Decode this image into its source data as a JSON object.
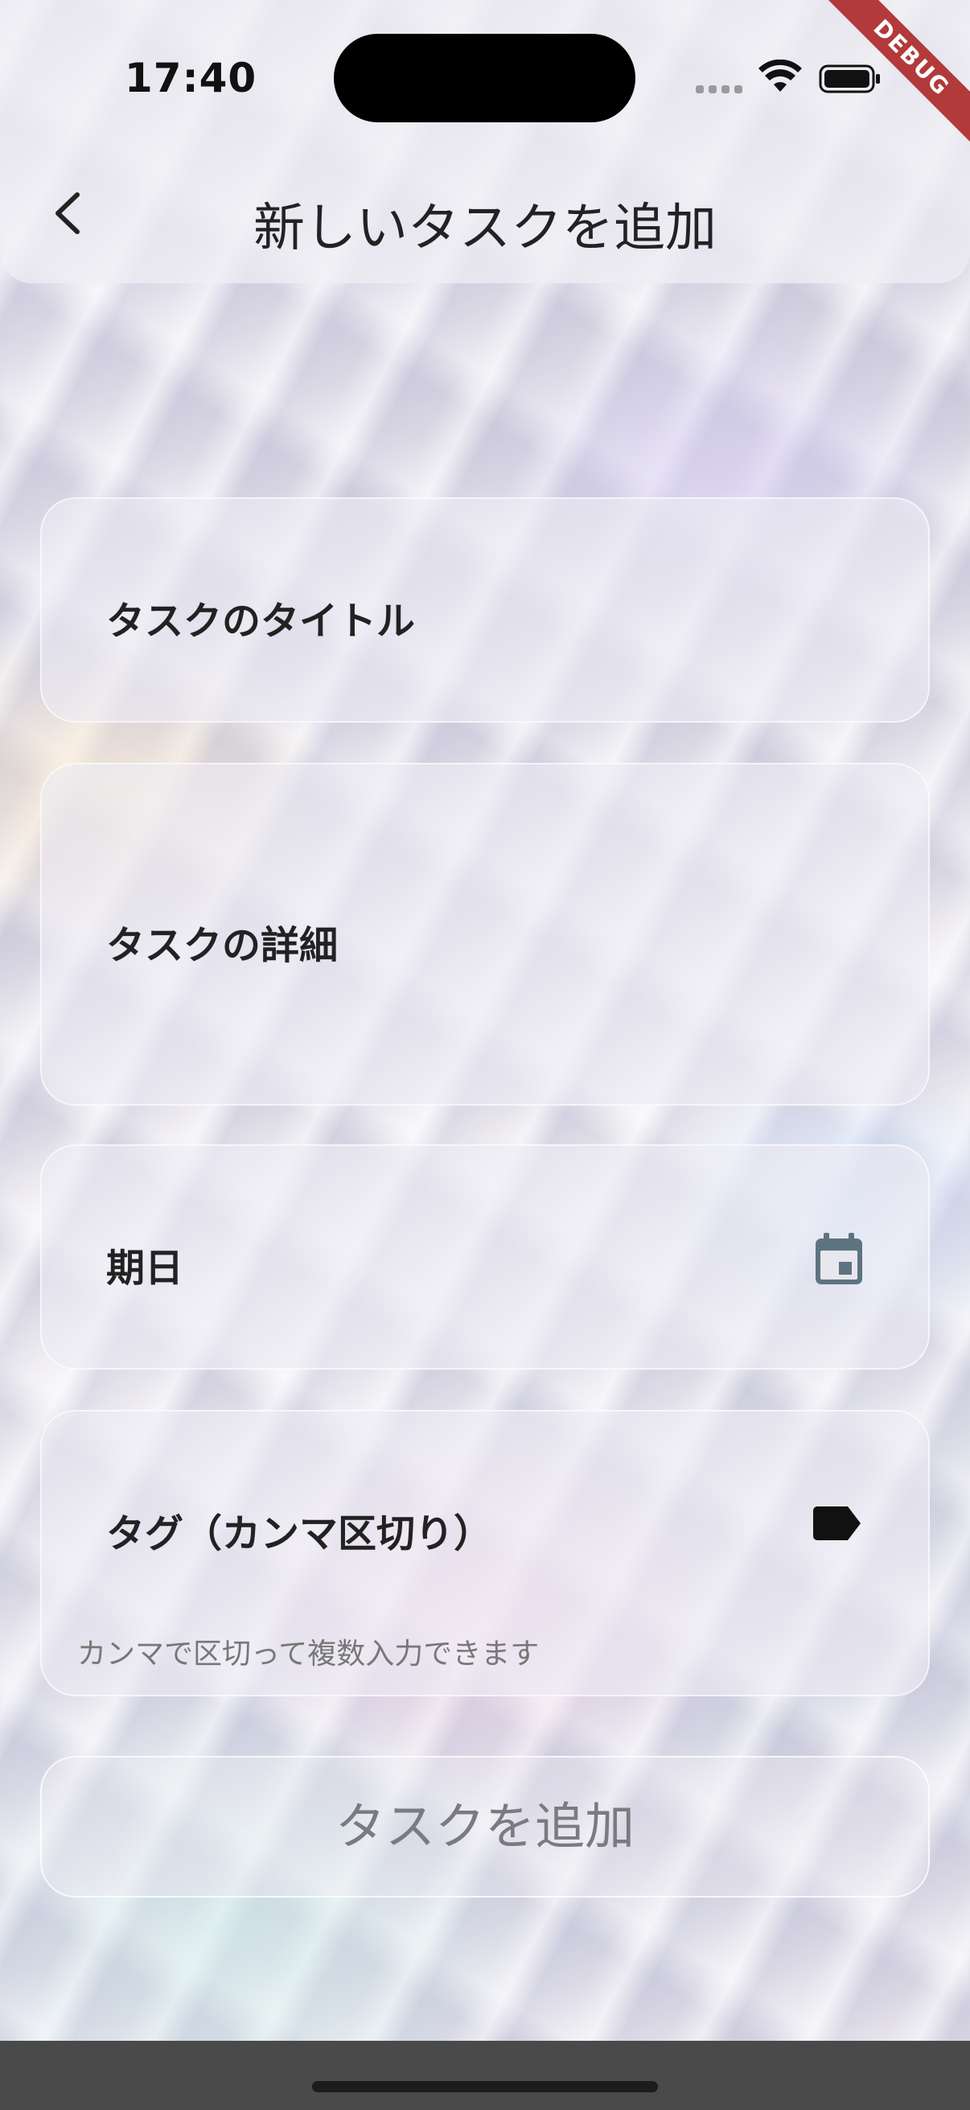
{
  "status_bar": {
    "time": "17:40",
    "debug_label": "DEBUG"
  },
  "header": {
    "back_icon": "chevron-left-icon",
    "title": "新しいタスクを追加"
  },
  "form": {
    "title_field": {
      "label": "タスクのタイトル"
    },
    "detail_field": {
      "label": "タスクの詳細"
    },
    "date_field": {
      "label": "期日",
      "icon": "calendar-icon",
      "icon_color": "#5d7480"
    },
    "tags_field": {
      "label": "タグ（カンマ区切り）",
      "icon": "tag-icon",
      "helper": "カンマで区切って複数入力できます"
    },
    "submit_label": "タスクを追加"
  },
  "colors": {
    "debug_ribbon": "#b23a3a",
    "bottom_bar": "#4a4a4a"
  }
}
